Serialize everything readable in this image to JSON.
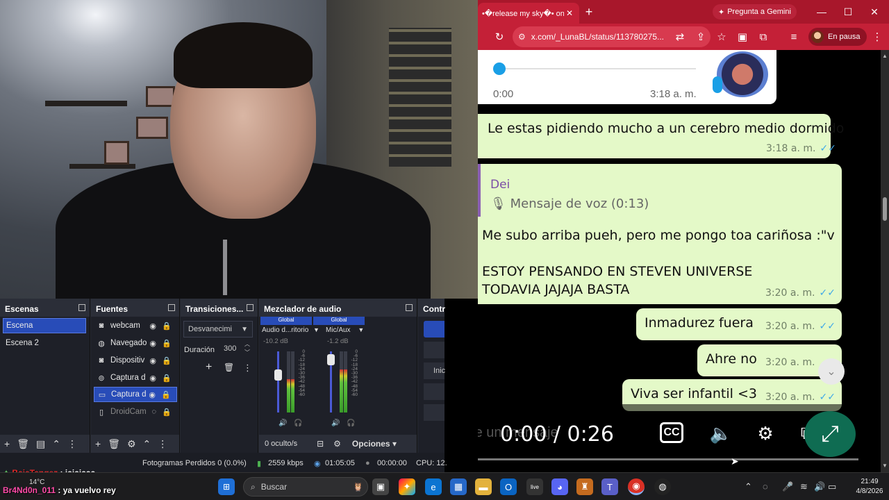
{
  "browser": {
    "tab_title": "•�release my sky�• on X: \"",
    "gemini_label": "Pregunta a Gemini",
    "url": "x.com/_LunaBL/status/113780275...",
    "paused_label": "En pausa",
    "accent_color": "#c42037"
  },
  "chat": {
    "voice": {
      "elapsed": "0:00",
      "stamp": "3:18 a. m."
    },
    "messages": [
      {
        "text": "Le estas pidiendo mucho a un cerebro medio dormido",
        "time": "3:18 a. m."
      },
      {
        "reply_name": "Dei",
        "reply_text": "Mensaje de voz (0:13)",
        "line1": "Me subo arriba pueh, pero me pongo toa cariñosa :\"v",
        "line2": "ESTOY PENSANDO EN STEVEN UNIVERSE",
        "line3": "TODAVIA JAJAJA BASTA",
        "time": "3:20 a. m."
      },
      {
        "text": "Inmadurez fuera",
        "time": "3:20 a. m."
      },
      {
        "text": "Ahre no",
        "time": "3:20 a. m."
      },
      {
        "text": "Viva ser infantil <3",
        "time": "3:20 a. m."
      }
    ],
    "input_placeholder": "Escribe un mensaje"
  },
  "video": {
    "time": "0:00 / 0:26",
    "cc_label": "CC"
  },
  "obs": {
    "scenes_title": "Escenas",
    "scenes": [
      "Escena",
      "Escena 2"
    ],
    "sources_title": "Fuentes",
    "sources": [
      "webcam",
      "Navegado",
      "Dispositiv",
      "Captura d",
      "Captura d",
      "DroidCam"
    ],
    "transitions_title": "Transiciones...",
    "transition_value": "Desvanecimi",
    "duration_label": "Duración",
    "duration_value": "300",
    "mixer_title": "Mezclador de audio",
    "mixer_channels": [
      {
        "head": "Global",
        "name": "Audio d...ritorio",
        "db": "-10.2 dB",
        "level": 0.55
      },
      {
        "head": "Global",
        "name": "Mic/Aux",
        "db": "-1.2 dB",
        "level": 0.7
      }
    ],
    "scale": [
      "0",
      "-6",
      "-12",
      "-18",
      "-24",
      "-30",
      "-36",
      "-42",
      "-48",
      "-54",
      "-60"
    ],
    "hidden_label": "0 oculto/s",
    "options_label": "Opciones",
    "controls_title": "Contr",
    "controls_partial": "Inic",
    "status": {
      "dropped": "Fotogramas Perdidos 0 (0.0%)",
      "bitrate": "2559 kbps",
      "live_time": "01:05:05",
      "rec_time": "00:00:00",
      "cpu": "CPU: 12."
    }
  },
  "stream_chat": [
    {
      "user": "BajaTangez",
      "msg": ": jajajaaa"
    },
    {
      "user": "Br4Nd0n_011",
      "msg": ": ya vuelvo rey"
    }
  ],
  "taskbar": {
    "weather": "14°C",
    "search_placeholder": "Buscar",
    "time": "21:49",
    "date": "4/8/2026"
  }
}
